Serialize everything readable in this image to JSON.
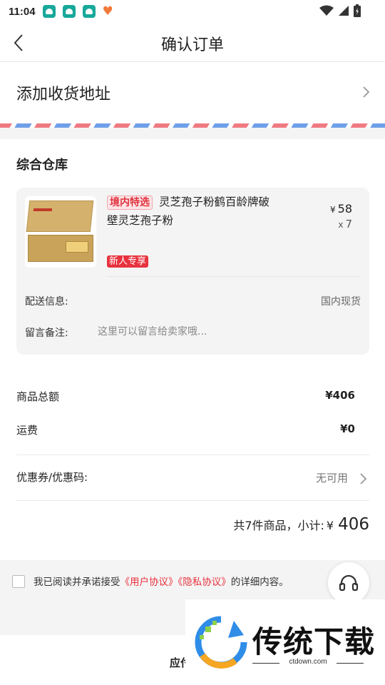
{
  "status_bar": {
    "time": "11:04",
    "notification_icons": [
      "app-icon",
      "app-icon",
      "app-icon",
      "heart-icon"
    ],
    "system_icons": [
      "wifi-icon",
      "signal-icon",
      "battery-icon"
    ]
  },
  "nav": {
    "title": "确认订单",
    "back_icon": "chevron-left-icon"
  },
  "address": {
    "label": "添加收货地址"
  },
  "warehouse": {
    "title": "综合仓库"
  },
  "product": {
    "tag": "境内特选",
    "name": "灵芝孢子粉鹤百龄牌破壁灵芝孢子粉",
    "price_symbol": "¥",
    "price": "58",
    "qty_symbol": "x",
    "qty": "7",
    "badge": "新人专享"
  },
  "delivery": {
    "label": "配送信息:",
    "value": "国内现货"
  },
  "remark": {
    "label": "留言备注:",
    "placeholder": "这里可以留言给卖家哦..."
  },
  "summary": {
    "goods_total_label": "商品总额",
    "goods_total_value": "¥406",
    "shipping_label": "运费",
    "shipping_value": "¥0",
    "coupon_label": "优惠券/优惠码:",
    "coupon_value": "无可用",
    "subtotal_prefix": "共7件商品，小计:",
    "subtotal_currency": "¥",
    "subtotal_amount": "406"
  },
  "agreement": {
    "prefix": "我已阅读并承诺接受",
    "user_agreement": "《用户协议》",
    "privacy_policy": "《隐私协议》",
    "suffix": "的详细内容。"
  },
  "bottom": {
    "payable_label": "应付"
  },
  "watermark": {
    "title": "传统下载",
    "url": "ctdown.com"
  },
  "colors": {
    "accent_red": "#e8323e",
    "airmail_blue": "#6f9fe8",
    "airmail_red": "#f07a82",
    "background_gray": "#f4f4f4"
  }
}
